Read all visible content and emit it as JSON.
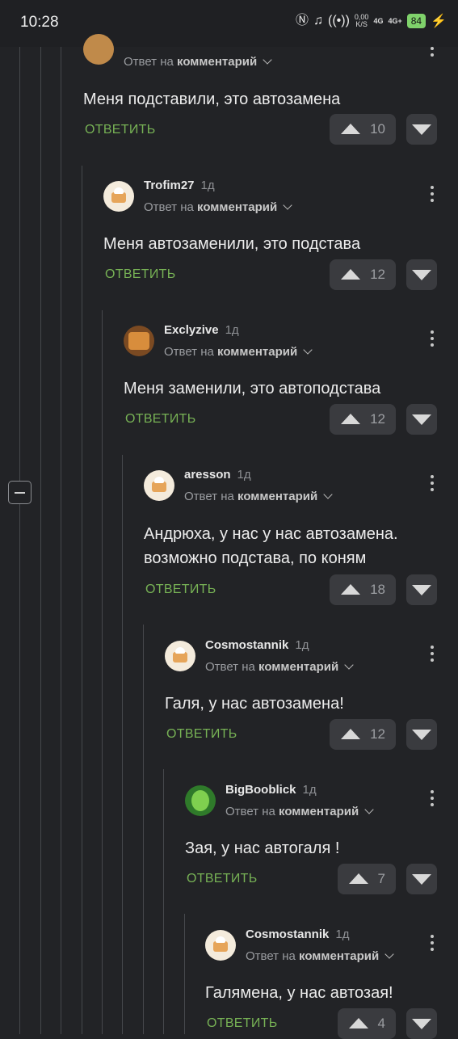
{
  "status_bar": {
    "time": "10:28",
    "net_speed_value": "0,00",
    "net_speed_unit": "K/S",
    "signal_1": "4G",
    "signal_2": "4G+",
    "battery": "84"
  },
  "labels": {
    "reply_prefix": "Ответ на",
    "reply_target": "комментарий",
    "reply_button": "ОТВЕТИТЬ"
  },
  "comments": [
    {
      "username": "",
      "time": "",
      "text": "Меня подставили, это автозамена",
      "votes": "10"
    },
    {
      "username": "Trofim27",
      "time": "1д",
      "text": "Меня автозаменили, это подстава",
      "votes": "12"
    },
    {
      "username": "Exclyzive",
      "time": "1д",
      "text": "Меня заменили, это автоподстава",
      "votes": "12"
    },
    {
      "username": "aresson",
      "time": "1д",
      "text": "Андрюха, у нас у нас автозамена. возможно подстава, по коням",
      "votes": "18"
    },
    {
      "username": "Cosmostannik",
      "time": "1д",
      "text": "Галя, у нас автозамена!",
      "votes": "12"
    },
    {
      "username": "BigBooblick",
      "time": "1д",
      "text": "Зая, у нас автогаля !",
      "votes": "7"
    },
    {
      "username": "Cosmostannik",
      "time": "1д",
      "text": "Галямена, у нас автозая!",
      "votes": "4"
    }
  ],
  "colors": {
    "accent_green": "#77b255",
    "background": "#222326"
  }
}
